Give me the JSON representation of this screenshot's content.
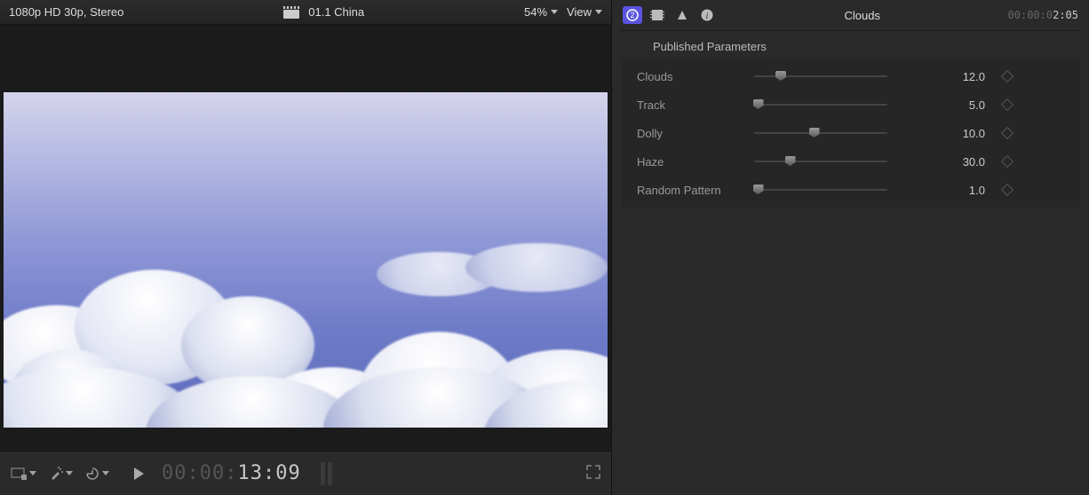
{
  "viewer": {
    "format_label": "1080p HD 30p, Stereo",
    "clip_name": "01.1 China",
    "zoom_label": "54%",
    "view_menu_label": "View",
    "timecode_dim": "00:00:",
    "timecode_bright": "13:09"
  },
  "inspector": {
    "title": "Clouds",
    "timecode_dim": "00:00:0",
    "timecode_bright": "2:05",
    "section_header": "Published Parameters",
    "params": [
      {
        "label": "Clouds",
        "value": "12.0",
        "pct": 20
      },
      {
        "label": "Track",
        "value": "5.0",
        "pct": 3
      },
      {
        "label": "Dolly",
        "value": "10.0",
        "pct": 45
      },
      {
        "label": "Haze",
        "value": "30.0",
        "pct": 27
      },
      {
        "label": "Random Pattern",
        "value": "1.0",
        "pct": 3
      }
    ]
  }
}
